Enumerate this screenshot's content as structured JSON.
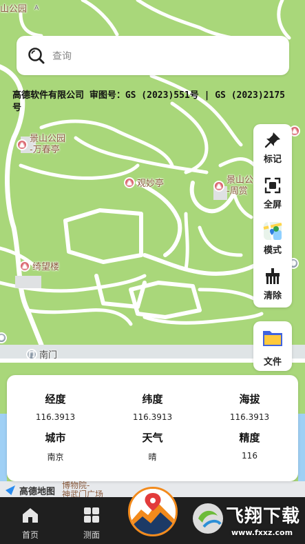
{
  "map": {
    "pois": {
      "jingshan_top": "山公园",
      "wanchunting_1": "景山公园",
      "wanchunting_2": "-万春亭",
      "guanmiaoting": "观妙亭",
      "zhoushang_1": "景山公",
      "zhoushang_2": "-周赏",
      "qiwanglou": "绮望楼",
      "nanmen": "南门",
      "museum_1": "博物院-",
      "museum_2": "神武门广场"
    },
    "amap_logo": "高德地图"
  },
  "search": {
    "placeholder": "查询"
  },
  "copyright": "高德软件有限公司 审图号：GS (2023)551号 | GS (2023)2175号",
  "tools": [
    {
      "label": "标记",
      "icon": "pin-icon"
    },
    {
      "label": "全屏",
      "icon": "fullscreen-icon"
    },
    {
      "label": "模式",
      "icon": "map-mode-icon"
    },
    {
      "label": "清除",
      "icon": "clear-icon"
    }
  ],
  "file_tool": {
    "label": "文件",
    "icon": "folder-icon"
  },
  "info": {
    "longitude": {
      "label": "经度",
      "value": "116.3913"
    },
    "latitude": {
      "label": "纬度",
      "value": "116.3913"
    },
    "altitude": {
      "label": "海拔",
      "value": "116.3913"
    },
    "city": {
      "label": "城市",
      "value": "南京"
    },
    "weather": {
      "label": "天气",
      "value": "晴"
    },
    "accuracy": {
      "label": "精度",
      "value": "116"
    }
  },
  "nav": {
    "home": "首页",
    "measure": "测面"
  },
  "watermark": {
    "text": "飞翔下载",
    "url": "www.fxxz.com"
  },
  "colors": {
    "map_green": "#a9d77a",
    "road": "#ffffff",
    "poi_pin": "#d9606a",
    "accent_orange": "#f28a1c",
    "nav_bg": "#1f1f1f"
  }
}
